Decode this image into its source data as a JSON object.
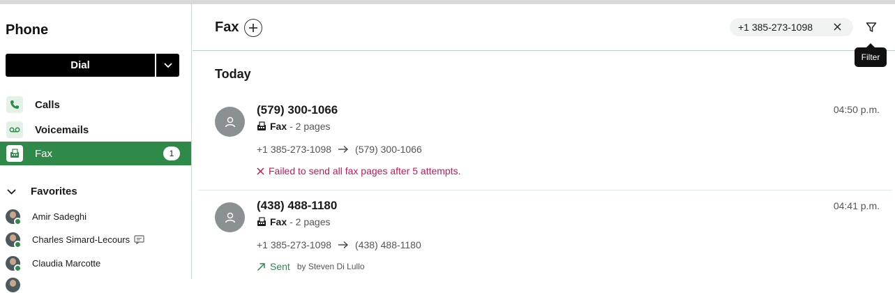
{
  "sidebar": {
    "title": "Phone",
    "dial_label": "Dial",
    "nav": [
      {
        "label": "Calls",
        "icon": "phone-icon"
      },
      {
        "label": "Voicemails",
        "icon": "voicemail-icon"
      },
      {
        "label": "Fax",
        "icon": "fax-icon",
        "badge": "1",
        "active": true
      }
    ],
    "favorites_label": "Favorites",
    "favorites": [
      {
        "name": "Amir Sadeghi"
      },
      {
        "name": "Charles Simard-Lecours",
        "has_chat": true
      },
      {
        "name": "Claudia Marcotte"
      }
    ]
  },
  "header": {
    "title": "Fax",
    "filter_chip": "+1 385-273-1098",
    "filter_tooltip": "Filter"
  },
  "list": {
    "day": "Today",
    "entries": [
      {
        "number": "(579) 300-1066",
        "type": "Fax",
        "pages": "- 2 pages",
        "from": "+1 385-273-1098",
        "to": "(579) 300-1066",
        "time": "04:50 p.m.",
        "status": "Failed to send all fax pages after 5 attempts."
      },
      {
        "number": "(438) 488-1180",
        "type": "Fax",
        "pages": "- 2 pages",
        "from": "+1 385-273-1098",
        "to": "(438) 488-1180",
        "time": "04:41 p.m.",
        "status": "Sent",
        "by": "by Steven Di Lullo"
      }
    ]
  },
  "colors": {
    "accent_green": "#2f8a49",
    "error_red": "#c2185b"
  }
}
